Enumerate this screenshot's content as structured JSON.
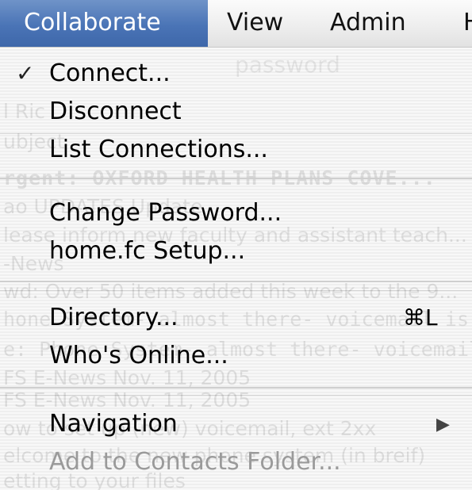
{
  "menubar": {
    "items": [
      {
        "label": "Collaborate",
        "active": true
      },
      {
        "label": "View"
      },
      {
        "label": "Admin"
      },
      {
        "label": "H"
      }
    ]
  },
  "menu": {
    "checkmark": "✓",
    "submenu_arrow": "▶",
    "groups": [
      [
        {
          "label": "Connect...",
          "checked": true
        },
        {
          "label": "Disconnect"
        },
        {
          "label": "List Connections..."
        }
      ],
      [
        {
          "label": "Change Password..."
        },
        {
          "label": "home.fc Setup..."
        }
      ],
      [
        {
          "label": "Directory...",
          "shortcut": "⌘L"
        },
        {
          "label": "Who's Online..."
        }
      ],
      [
        {
          "label": "Navigation",
          "has_submenu": true
        },
        {
          "label": "Add to Contacts Folder...",
          "disabled": true
        }
      ]
    ]
  },
  "background_window": {
    "password_hint": "password",
    "lines": [
      "l Ric",
      "ubject",
      "rgent: OXFORD HEALTH PLANS COVE...",
      "ao UPDATES Update",
      "lease inform new faculty and assistant teach...",
      "-News",
      "wd: Over 50 items added this week to the 9...",
      "hone System- almost there- voicemail is ...",
      "e: Phone System- almost there- voicemail i...",
      "FS E-News Nov. 11, 2005",
      "FS E-News Nov. 11, 2005",
      "ow to set up (new) voicemail, ext 2xx",
      "elcome to the new phone system (in breif)",
      "etting to your files"
    ]
  },
  "colors": {
    "menubar_highlight": "#4a74b6",
    "disabled_text": "#9a9a9a",
    "separator": "#cfcfcf"
  }
}
